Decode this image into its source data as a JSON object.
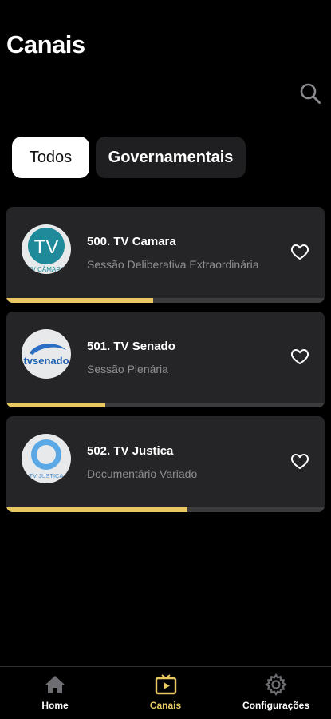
{
  "header": {
    "title": "Canais",
    "search_icon": "search-icon"
  },
  "filters": [
    {
      "label": "Todos",
      "active": true
    },
    {
      "label": "Governamentais",
      "active": false
    }
  ],
  "channels": [
    {
      "name": "500. TV Camara",
      "program": "Sessão Deliberativa Extraordinária",
      "progress": 0.46,
      "logo_text": "TV CÂMARA",
      "favorite": false
    },
    {
      "name": "501. TV Senado",
      "program": "Sessão Plenária",
      "progress": 0.31,
      "logo_text": "tvsenado",
      "favorite": false
    },
    {
      "name": "502. TV Justica",
      "program": "Documentário Variado",
      "progress": 0.57,
      "logo_text": "TV JUSTIÇA",
      "favorite": false
    }
  ],
  "nav": [
    {
      "label": "Home",
      "icon": "home-icon",
      "active": false
    },
    {
      "label": "Canais",
      "icon": "tv-play-icon",
      "active": true
    },
    {
      "label": "Configurações",
      "icon": "gear-icon",
      "active": false
    }
  ],
  "colors": {
    "accent": "#E8C860",
    "card": "#252527",
    "muted_text": "#8F8F93",
    "inactive_nav": "#6E6E72"
  }
}
